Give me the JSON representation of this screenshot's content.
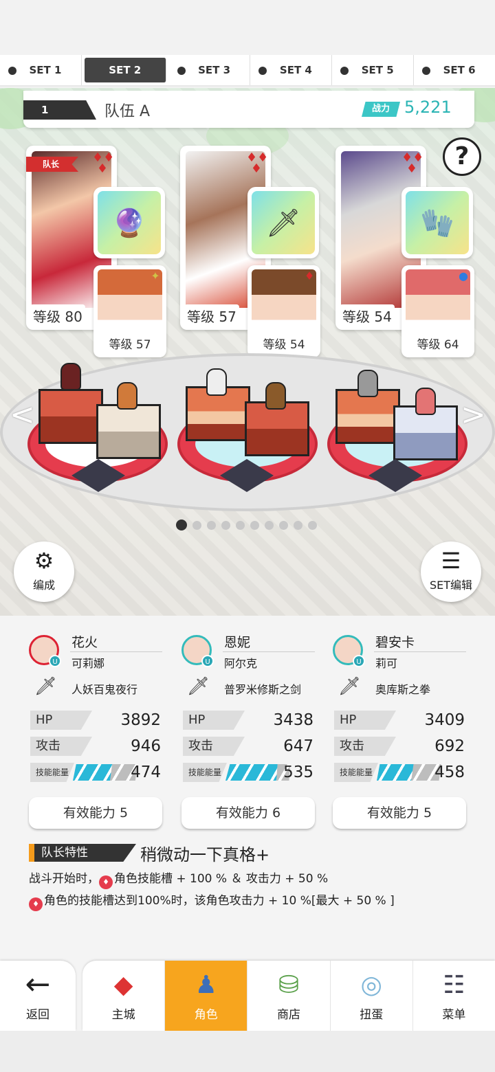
{
  "tabs": [
    {
      "label": "SET 1",
      "active": false
    },
    {
      "label": "SET 2",
      "active": true
    },
    {
      "label": "SET 3",
      "active": false
    },
    {
      "label": "SET 4",
      "active": false
    },
    {
      "label": "SET 5",
      "active": false
    },
    {
      "label": "SET 6",
      "active": false
    }
  ],
  "team": {
    "number": "1",
    "name": "队伍 A",
    "power_label": "战力",
    "power_value": "5,221"
  },
  "help_icon": "?",
  "leader_badge": "队长",
  "cards": [
    {
      "level": "等级 80",
      "suit": "diamond-suit",
      "item_icon": "orb-icon",
      "sub_level": "等级 57",
      "sub_mark": "✦"
    },
    {
      "level": "等级 57",
      "suit": "diamond-suit",
      "item_icon": "sword-icon",
      "sub_level": "等级 54",
      "sub_mark": "♦"
    },
    {
      "level": "等级 54",
      "suit": "diamond-suit",
      "item_icon": "gauntlet-icon",
      "sub_level": "等级 64",
      "sub_mark": "●"
    }
  ],
  "pager": {
    "count": 10,
    "active": 0
  },
  "formation_button": "编成",
  "set_edit_button": "SET编辑",
  "characters": [
    {
      "name": "花火",
      "sub": "可莉娜",
      "weapon": "人妖百鬼夜行",
      "hp_label": "HP",
      "hp": "3892",
      "atk_label": "攻击",
      "atk": "946",
      "energy_label": "技能能量",
      "energy": "474",
      "ability": "有效能力 5"
    },
    {
      "name": "恩妮",
      "sub": "阿尔克",
      "weapon": "普罗米修斯之剑",
      "hp_label": "HP",
      "hp": "3438",
      "atk_label": "攻击",
      "atk": "647",
      "energy_label": "技能能量",
      "energy": "535",
      "ability": "有效能力 6"
    },
    {
      "name": "碧安卡",
      "sub": "莉可",
      "weapon": "奥库斯之拳",
      "hp_label": "HP",
      "hp": "3409",
      "atk_label": "攻击",
      "atk": "692",
      "energy_label": "技能能量",
      "energy": "458",
      "ability": "有效能力 5"
    }
  ],
  "leader_trait": {
    "label": "队长特性",
    "title": "稍微动一下真格+",
    "line1": "战斗开始时，",
    "line1b": "角色技能槽 + 100 % ＆ 攻击力 + 50 %",
    "line2": "角色的技能槽达到100%时，该角色攻击力 + 10 %[最大 + 50 % ]"
  },
  "nav": {
    "back": "返回",
    "items": [
      {
        "label": "主城",
        "icon": "castle-icon",
        "active": false
      },
      {
        "label": "角色",
        "icon": "character-icon",
        "active": true
      },
      {
        "label": "商店",
        "icon": "shop-icon",
        "active": false
      },
      {
        "label": "扭蛋",
        "icon": "gacha-icon",
        "active": false
      },
      {
        "label": "菜单",
        "icon": "menu-icon",
        "active": false
      }
    ]
  },
  "colors": {
    "accent": "#f7a51e",
    "power": "#2ab4b4",
    "suit": "#d62b2b",
    "pedestal": "#e53c4d"
  }
}
